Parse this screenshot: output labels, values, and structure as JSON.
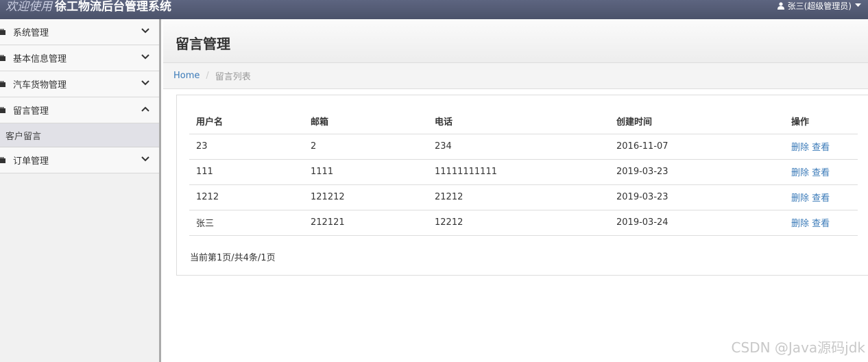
{
  "header": {
    "welcome": "欢迎使用",
    "system_name": "徐工物流后台管理系统",
    "user": "张三(超级管理员)"
  },
  "sidebar": {
    "items": [
      {
        "label": "系统管理",
        "expanded": false
      },
      {
        "label": "基本信息管理",
        "expanded": false
      },
      {
        "label": "汽车货物管理",
        "expanded": false
      },
      {
        "label": "留言管理",
        "expanded": true,
        "children": [
          {
            "label": "客户留言"
          }
        ]
      },
      {
        "label": "订单管理",
        "expanded": false
      }
    ]
  },
  "main": {
    "title": "留言管理",
    "breadcrumb": {
      "home": "Home",
      "current": "留言列表"
    },
    "table": {
      "columns": [
        "用户名",
        "邮箱",
        "电话",
        "创建时间",
        "操作"
      ],
      "rows": [
        {
          "username": "23",
          "email": "2",
          "phone": "234",
          "created": "2016-11-07"
        },
        {
          "username": "111",
          "email": "1111",
          "phone": "11111111111",
          "created": "2019-03-23"
        },
        {
          "username": "1212",
          "email": "121212",
          "phone": "21212",
          "created": "2019-03-23"
        },
        {
          "username": "张三",
          "email": "212121",
          "phone": "12212",
          "created": "2019-03-24"
        }
      ],
      "actions": {
        "delete": "删除",
        "view": "查看"
      }
    },
    "pager": "当前第1页/共4条/1页"
  },
  "watermark": "CSDN @Java源码jdk"
}
